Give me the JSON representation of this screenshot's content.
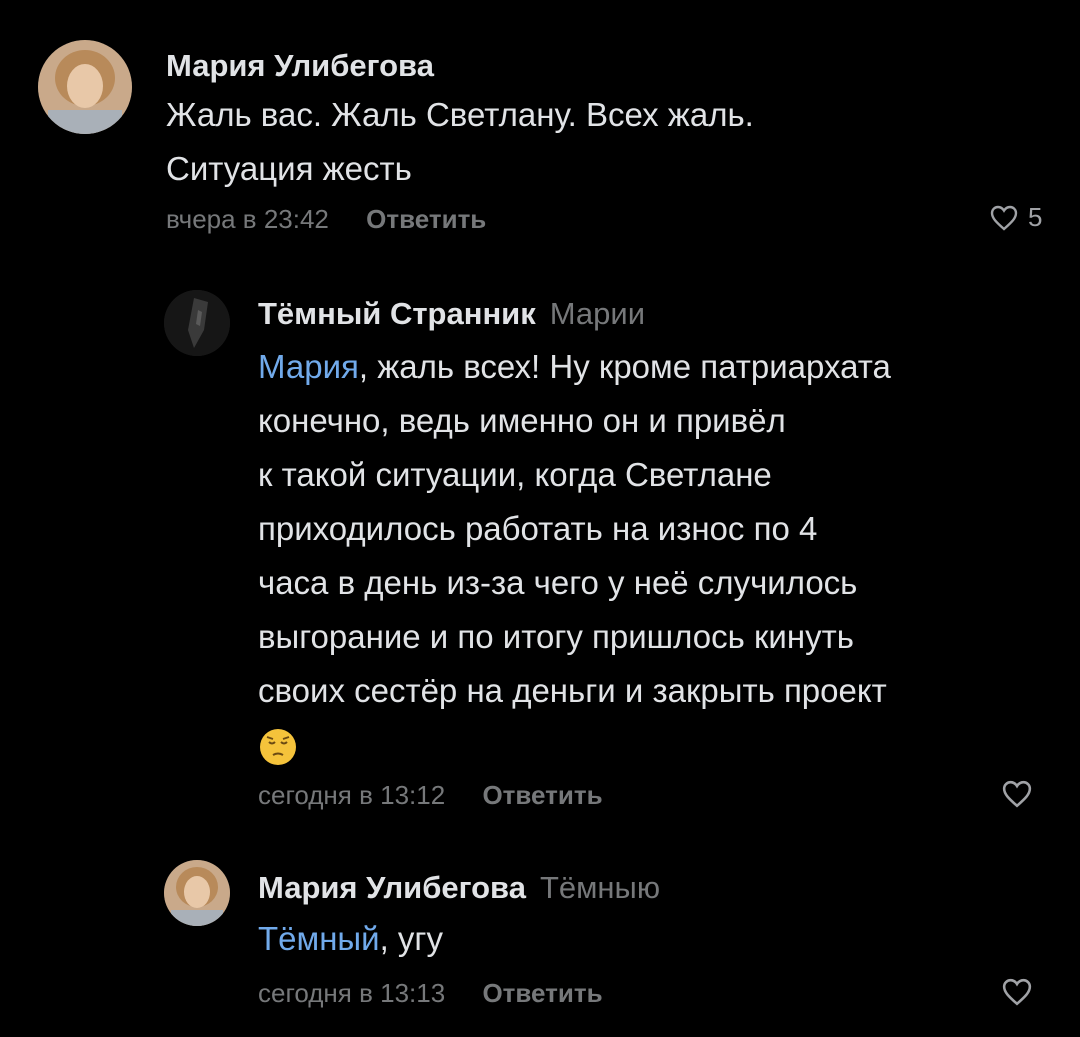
{
  "comments": [
    {
      "author": "Мария Улибегова",
      "reply_to": "",
      "lines": [
        "Жаль вас. Жаль Светлану. Всех жаль.",
        "Ситуация жесть"
      ],
      "time": "вчера в 23:42",
      "reply_label": "Ответить",
      "likes": "5"
    },
    {
      "author": "Тёмный Странник",
      "reply_to": "Марии",
      "mention": "Мария",
      "first_line_rest": ", жаль всех! Ну кроме патриархата",
      "lines": [
        "конечно, ведь именно он и привёл",
        "к такой ситуации, когда Светлане",
        "приходилось работать на износ по 4",
        "часа в день из-за чего у неё случилось",
        "выгорание и по итогу пришлось кинуть",
        "своих сестёр на деньги и закрыть проект"
      ],
      "emoji": "pensive-face",
      "time": "сегодня в 13:12",
      "reply_label": "Ответить"
    },
    {
      "author": "Мария Улибегова",
      "reply_to": "Тёмныю",
      "mention": "Тёмный",
      "text_rest": ", угу",
      "time": "сегодня в 13:13",
      "reply_label": "Ответить"
    }
  ],
  "colors": {
    "background": "#000000",
    "text": "#e1e3e6",
    "secondary": "#76787a",
    "mention": "#71aaeb"
  }
}
